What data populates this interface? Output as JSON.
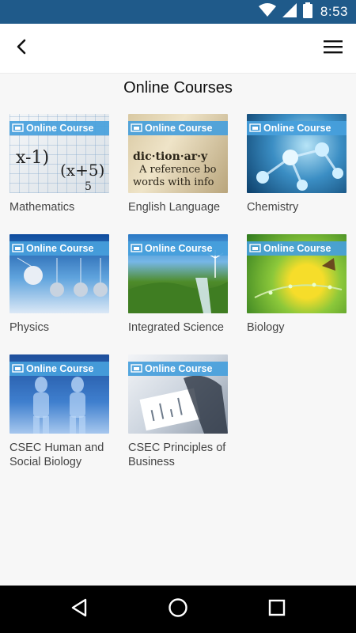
{
  "status_bar": {
    "time": "8:53",
    "icons": [
      "wifi-icon",
      "signal-icon",
      "battery-icon"
    ],
    "color": "#1f5a8a"
  },
  "app_bar": {
    "back_icon": "chevron-left-icon",
    "menu_icon": "hamburger-menu-icon"
  },
  "page": {
    "title": "Online Courses"
  },
  "badge": {
    "text": "Online Course",
    "color": "#46a0dc"
  },
  "courses": [
    {
      "label": "Mathematics"
    },
    {
      "label": "English Language"
    },
    {
      "label": "Chemistry"
    },
    {
      "label": "Physics"
    },
    {
      "label": "Integrated Science"
    },
    {
      "label": "Biology"
    },
    {
      "label": "CSEC Human and Social Biology"
    },
    {
      "label": "CSEC Principles of Business"
    }
  ],
  "nav_bar": {
    "icons": [
      "back-triangle-icon",
      "home-circle-icon",
      "recents-square-icon"
    ]
  }
}
